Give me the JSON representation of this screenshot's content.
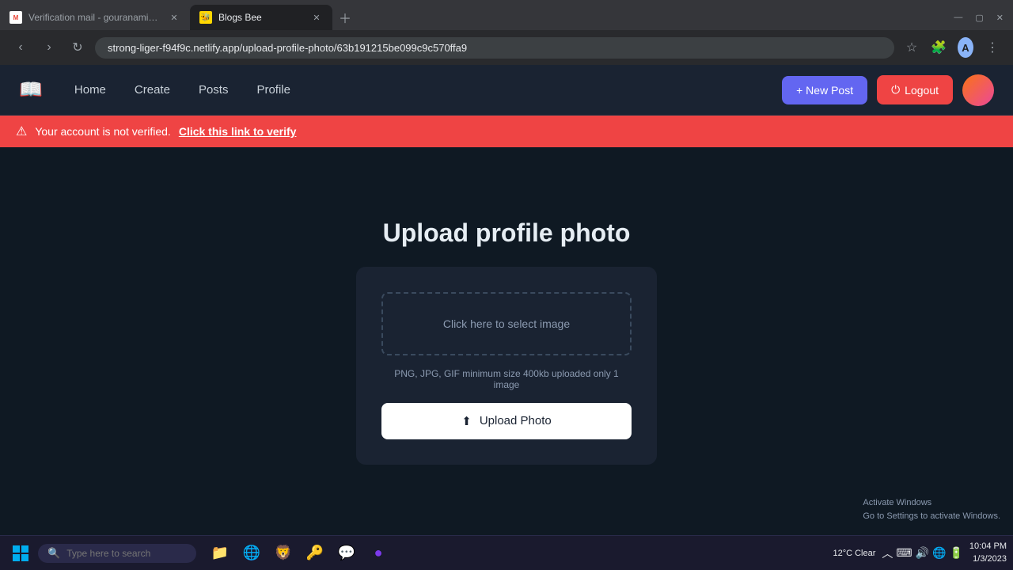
{
  "browser": {
    "tabs": [
      {
        "id": "tab1",
        "title": "Verification mail - gouranamika...",
        "favicon": "M",
        "active": false
      },
      {
        "id": "tab2",
        "title": "Blogs Bee",
        "favicon": "🐝",
        "active": true
      }
    ],
    "address": "strong-liger-f94f9c.netlify.app/upload-profile-photo/63b191215be099c9c570ffa9"
  },
  "navbar": {
    "logo_icon": "📖",
    "links": [
      {
        "label": "Home",
        "active": false
      },
      {
        "label": "Create",
        "active": false
      },
      {
        "label": "Posts",
        "active": false
      },
      {
        "label": "Profile",
        "active": false
      }
    ],
    "new_post_label": "+ New Post",
    "logout_label": "Logout"
  },
  "notification": {
    "text": "Your account is not verified.",
    "link_text": "Click this link to verify"
  },
  "page": {
    "title": "Upload profile photo",
    "select_image_placeholder": "Click here to select image",
    "file_info": "PNG, JPG, GIF minimum size 400kb uploaded only 1 image",
    "upload_btn_label": "Upload Photo"
  },
  "activate_windows": {
    "line1": "Activate Windows",
    "line2": "Go to Settings to activate Windows."
  },
  "taskbar": {
    "search_placeholder": "Type here to search",
    "time": "10:04 PM",
    "date": "1/3/2023",
    "weather": "12°C  Clear"
  }
}
